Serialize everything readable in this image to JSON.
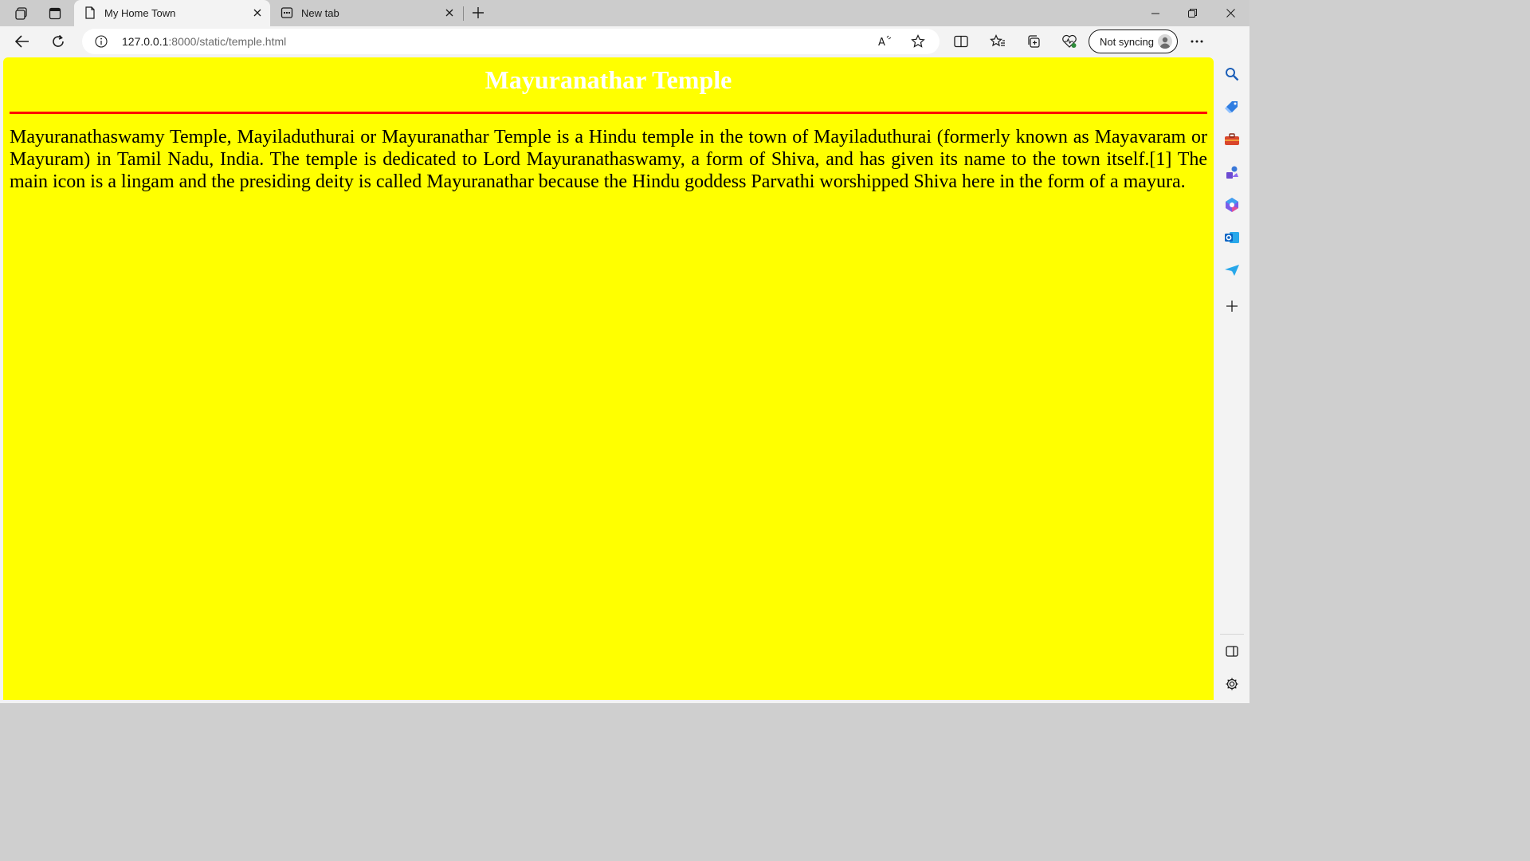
{
  "browser": {
    "tabs": [
      {
        "title": "My Home Town",
        "active": true
      },
      {
        "title": "New tab",
        "active": false
      }
    ],
    "address": {
      "host": "127.0.0.1",
      "rest": ":8000/static/temple.html"
    },
    "profile": {
      "label": "Not syncing"
    }
  },
  "page": {
    "heading": "Mayuranathar Temple",
    "paragraph": "Mayuranathaswamy Temple, Mayiladuthurai or Mayuranathar Temple is a Hindu temple in the town of Mayiladuthurai (formerly known as Mayavaram or Mayuram) in Tamil Nadu, India. The temple is dedicated to Lord Mayuranathaswamy, a form of Shiva, and has given its name to the town itself.[1] The main icon is a lingam and the presiding deity is called Mayuranathar because the Hindu goddess Parvathi worshipped Shiva here in the form of a mayura.",
    "background_color": "#ffff00",
    "heading_color": "#ffffff",
    "rule_color": "#ff0000"
  },
  "icons": {
    "tab_strip": [
      "workspaces-icon",
      "vertical-tabs-icon"
    ],
    "toolbar": [
      "back-icon",
      "refresh-icon",
      "info-icon",
      "read-aloud-icon",
      "favorite-star-icon",
      "split-screen-icon",
      "favorites-icon",
      "collections-icon",
      "browser-essentials-icon",
      "more-menu-icon",
      "copilot-icon"
    ],
    "sidebar": [
      "search-icon",
      "shopping-icon",
      "tools-icon",
      "games-icon",
      "microsoft-365-icon",
      "outlook-icon",
      "send-icon",
      "add-icon",
      "sidebar-toggle-icon",
      "settings-icon"
    ]
  }
}
